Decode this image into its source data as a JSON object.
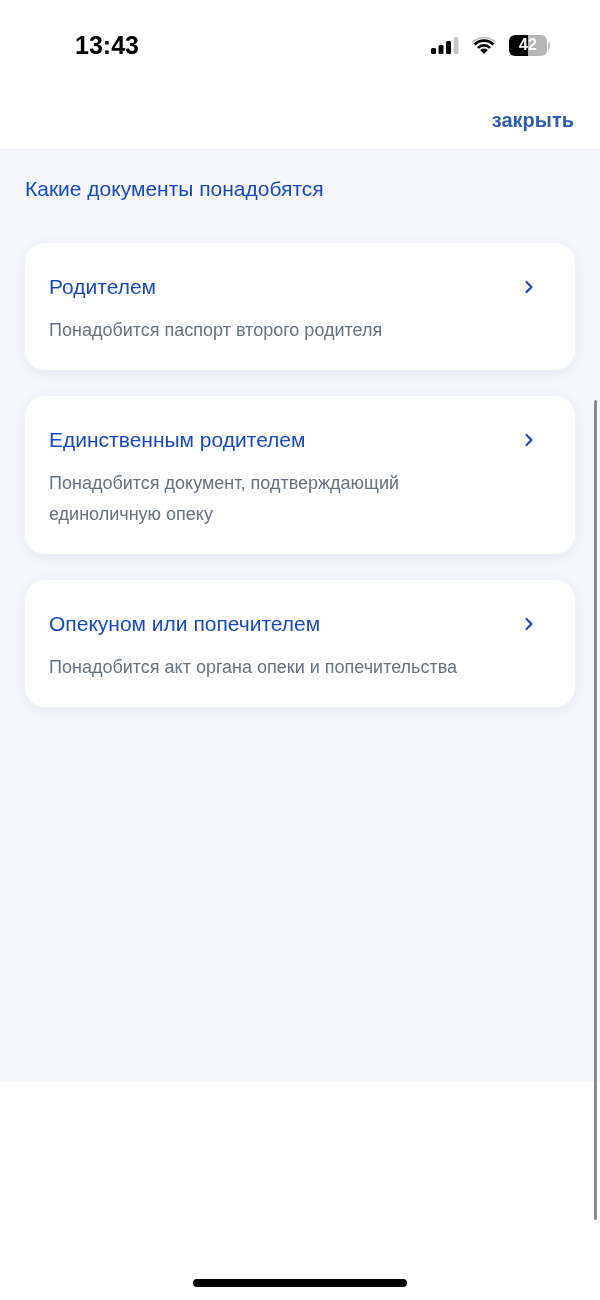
{
  "status_bar": {
    "time": "13:43",
    "battery": "42"
  },
  "header": {
    "close_link": "закрыть"
  },
  "title": "Какие документы понадобятся",
  "options": [
    {
      "title": "Родителем",
      "description": "Понадобится паспорт второго родителя"
    },
    {
      "title": "Единственным родителем",
      "description": "Понадобится документ, подтверждающий единоличную опеку"
    },
    {
      "title": "Опекуном или попечителем",
      "description": "Понадобится акт органа опеки и попечительства"
    }
  ]
}
